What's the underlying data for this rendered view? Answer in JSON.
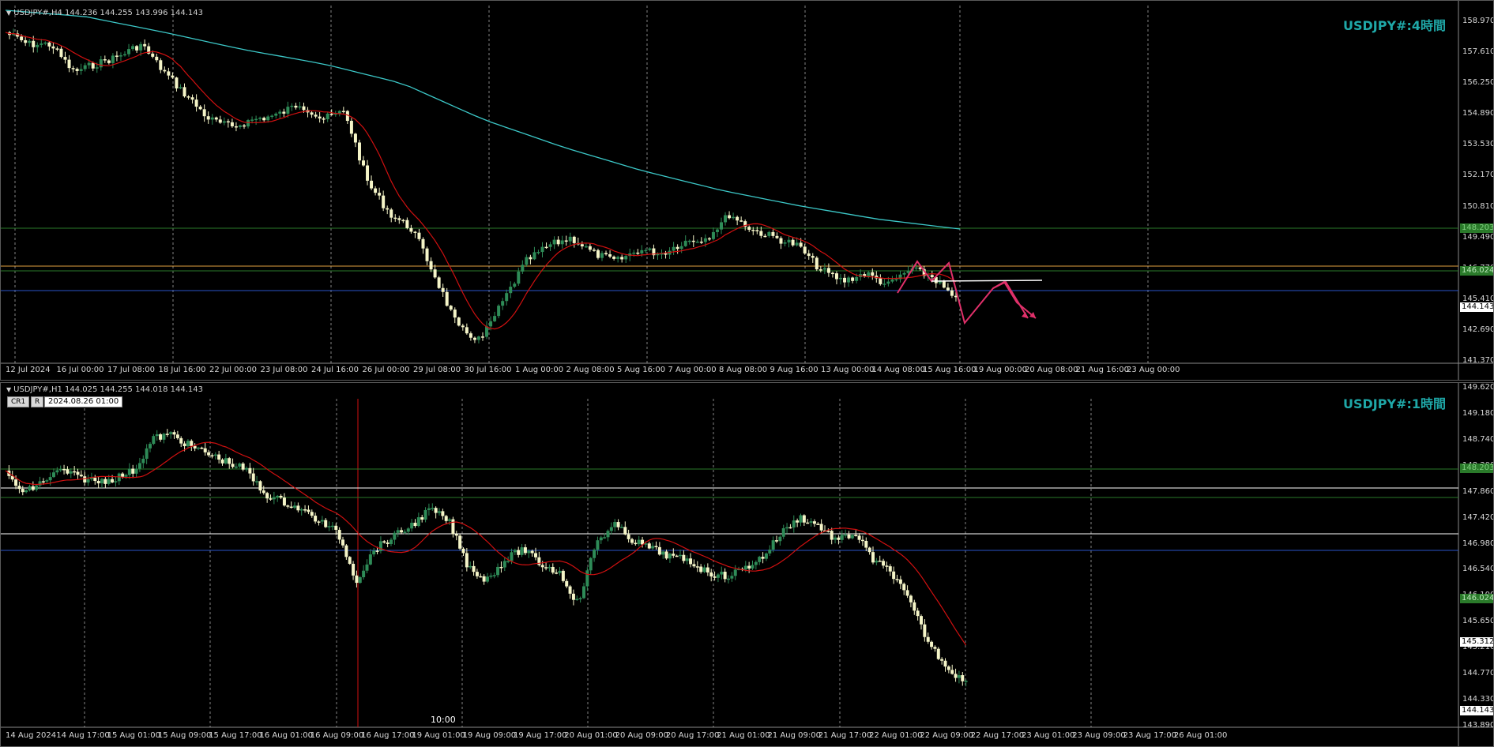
{
  "h4": {
    "header": "USDJPY#,H4  144.236 144.255 143.996 144.143",
    "title": "USDJPY#:4時間",
    "price_axis": [
      "158.970",
      "157.610",
      "156.250",
      "154.890",
      "153.530",
      "152.170",
      "150.810",
      "149.490",
      "146.770",
      "145.410",
      "142.690",
      "141.370"
    ],
    "time_axis": [
      "12 Jul 2024",
      "16 Jul 00:00",
      "17 Jul 08:00",
      "18 Jul 16:00",
      "22 Jul 00:00",
      "23 Jul 08:00",
      "24 Jul 16:00",
      "26 Jul 00:00",
      "29 Jul 08:00",
      "30 Jul 16:00",
      "1 Aug 00:00",
      "2 Aug 08:00",
      "5 Aug 16:00",
      "7 Aug 00:00",
      "8 Aug 08:00",
      "9 Aug 16:00",
      "13 Aug 00:00",
      "14 Aug 08:00",
      "15 Aug 16:00",
      "19 Aug 00:00",
      "20 Aug 08:00",
      "21 Aug 16:00",
      "23 Aug 00:00"
    ],
    "tags": {
      "green_line": "148.203",
      "green_line2": "146.024",
      "last_price": "144.143"
    }
  },
  "h1": {
    "header": "USDJPY#,H1  144.025 144.255 144.018 144.143",
    "title": "USDJPY#:1時間",
    "cr_button": "CR1",
    "r_button": "R",
    "date_field": "2024.08.26 01:00",
    "vline_label": "10:00",
    "price_axis": [
      "149.620",
      "149.180",
      "148.740",
      "148.300",
      "147.860",
      "147.420",
      "146.980",
      "146.540",
      "146.100",
      "145.650",
      "145.210",
      "144.770",
      "144.330",
      "143.890"
    ],
    "time_axis": [
      "14 Aug 2024",
      "14 Aug 17:00",
      "15 Aug 01:00",
      "15 Aug 09:00",
      "15 Aug 17:00",
      "16 Aug 01:00",
      "16 Aug 09:00",
      "16 Aug 17:00",
      "19 Aug 01:00",
      "19 Aug 09:00",
      "19 Aug 17:00",
      "20 Aug 01:00",
      "20 Aug 09:00",
      "20 Aug 17:00",
      "21 Aug 01:00",
      "21 Aug 09:00",
      "21 Aug 17:00",
      "22 Aug 01:00",
      "22 Aug 09:00",
      "22 Aug 17:00",
      "23 Aug 01:00",
      "23 Aug 09:00",
      "23 Aug 17:00",
      "26 Aug 01:00"
    ],
    "tags": {
      "green_line": "148.203",
      "green_line2": "146.024",
      "white_line": "145.312",
      "last_price": "144.143"
    }
  },
  "colors": {
    "bull": "#2e8b57",
    "bear": "#f5f5c8",
    "ma_fast": "#d01010",
    "ma_slow": "#3cc8c8",
    "green_level": "#2a7a2a",
    "blue_level": "#2a55c8",
    "orange_level": "#e0a040",
    "white_level": "#ffffff",
    "pink_projection": "#e0306a",
    "title_color": "#1fa8a8"
  }
}
